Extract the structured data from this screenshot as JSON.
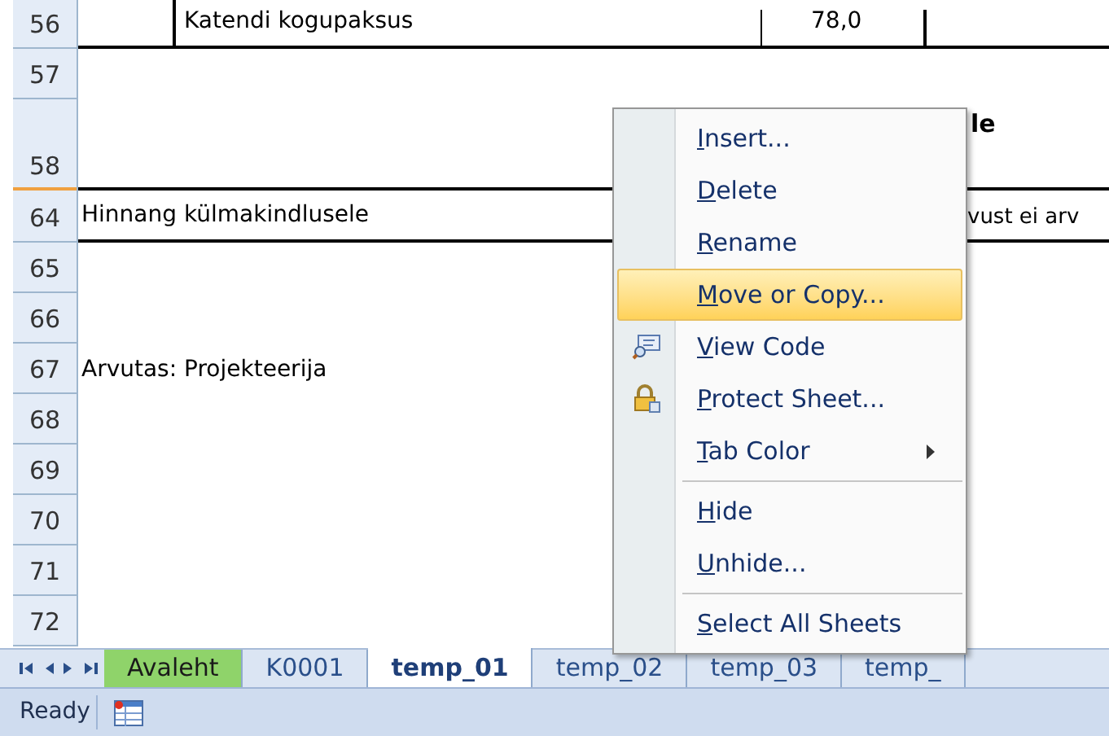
{
  "rows": [
    {
      "number": "56",
      "cells": [
        {
          "text": "Katendi kogupaksus",
          "kind": "indented"
        },
        {
          "text": "78,0",
          "kind": "value"
        }
      ]
    },
    {
      "number": "57",
      "cells": []
    },
    {
      "number": "58",
      "cells": [
        {
          "text": "le",
          "kind": "heading"
        }
      ]
    },
    {
      "number": "64",
      "cells": [
        {
          "text": "Hinnang külmakindlusele",
          "kind": "label"
        },
        {
          "text": "vust ei arv",
          "kind": "right"
        }
      ]
    },
    {
      "number": "65",
      "cells": []
    },
    {
      "number": "66",
      "cells": []
    },
    {
      "number": "67",
      "cells": [
        {
          "text": "Arvutas: Projekteerija",
          "kind": "label"
        }
      ]
    },
    {
      "number": "68",
      "cells": []
    },
    {
      "number": "69",
      "cells": []
    },
    {
      "number": "70",
      "cells": []
    },
    {
      "number": "71",
      "cells": []
    },
    {
      "number": "72",
      "cells": []
    }
  ],
  "context_menu": [
    {
      "kind": "plain",
      "label": "Insert...",
      "selected": false
    },
    {
      "kind": "plain",
      "label": "Delete",
      "selected": false
    },
    {
      "kind": "plain",
      "label": "Rename",
      "selected": false
    },
    {
      "kind": "plain",
      "label": "Move or Copy...",
      "selected": true
    },
    {
      "kind": "view",
      "label": "View Code",
      "selected": false
    },
    {
      "kind": "protect",
      "label": "Protect Sheet...",
      "selected": false
    },
    {
      "kind": "submenu",
      "label": "Tab Color",
      "selected": false
    },
    {
      "kind": "separator"
    },
    {
      "kind": "plain",
      "label": "Hide",
      "selected": false
    },
    {
      "kind": "plain",
      "label": "Unhide...",
      "selected": false
    },
    {
      "kind": "separator"
    },
    {
      "kind": "plain",
      "label": "Select All Sheets",
      "selected": false
    }
  ],
  "sheet_tabs": [
    {
      "label": "Avaleht",
      "selected": false,
      "color": "#8fd36a"
    },
    {
      "label": "K0001",
      "selected": false
    },
    {
      "label": "temp_01",
      "selected": true
    },
    {
      "label": "temp_02",
      "selected": false
    },
    {
      "label": "temp_03",
      "selected": false
    },
    {
      "label": "temp_",
      "selected": false
    }
  ],
  "status_bar": {
    "text": "Ready"
  }
}
